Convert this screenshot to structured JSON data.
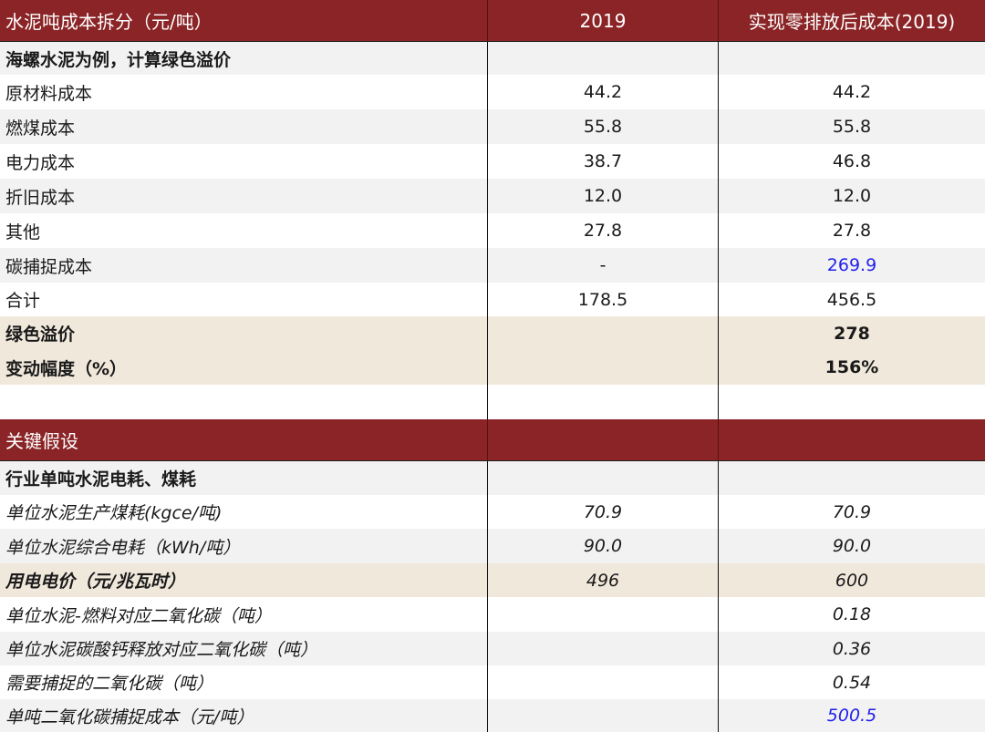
{
  "header": {
    "col0": "水泥吨成本拆分（元/吨）",
    "col1": "2019",
    "col2": "实现零排放后成本(2019)"
  },
  "section1_title": "海螺水泥为例，计算绿色溢价",
  "cost_rows": [
    {
      "label": "原材料成本",
      "v2019": "44.2",
      "vzero": "44.2"
    },
    {
      "label": "燃煤成本",
      "v2019": "55.8",
      "vzero": "55.8"
    },
    {
      "label": "电力成本",
      "v2019": "38.7",
      "vzero": "46.8"
    },
    {
      "label": "折旧成本",
      "v2019": "12.0",
      "vzero": "12.0"
    },
    {
      "label": "其他",
      "v2019": "27.8",
      "vzero": "27.8"
    },
    {
      "label": "碳捕捉成本",
      "v2019": "-",
      "vzero": "269.9"
    },
    {
      "label": "合计",
      "v2019": "178.5",
      "vzero": "456.5"
    }
  ],
  "premium": {
    "label": "绿色溢价",
    "value": "278"
  },
  "change": {
    "label": "变动幅度（%）",
    "value": "156%"
  },
  "header2": {
    "col0": "关键假设"
  },
  "section2_title": "行业单吨水泥电耗、煤耗",
  "assumptions": [
    {
      "label": "单位水泥生产煤耗(kgce/吨)",
      "v2019": "70.9",
      "vzero": "70.9"
    },
    {
      "label": "单位水泥综合电耗（kWh/吨）",
      "v2019": "90.0",
      "vzero": "90.0"
    },
    {
      "label": "用电电价（元/兆瓦时）",
      "v2019": "496",
      "vzero": "600"
    },
    {
      "label": "单位水泥-燃料对应二氧化碳（吨）",
      "v2019": "",
      "vzero": "0.18"
    },
    {
      "label": "单位水泥碳酸钙释放对应二氧化碳（吨）",
      "v2019": "",
      "vzero": "0.36"
    },
    {
      "label": "需要捕捉的二氧化碳（吨）",
      "v2019": "",
      "vzero": "0.54"
    },
    {
      "label": "单吨二氧化碳捕捉成本（元/吨）",
      "v2019": "",
      "vzero": "500.5"
    }
  ],
  "colors": {
    "header_bg": "#8b2426",
    "highlight_bg": "#f1e8dc",
    "stripe_bg": "#f2f2f2",
    "link_blue": "#2222ee"
  }
}
